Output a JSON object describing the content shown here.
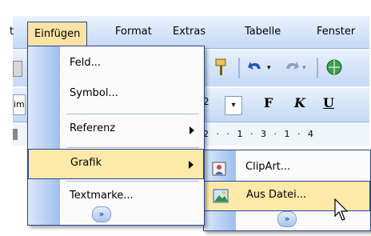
{
  "menubar": {
    "items": [
      {
        "label": "t"
      },
      {
        "label": "Einfügen"
      },
      {
        "label": "Format"
      },
      {
        "label": "Extras"
      },
      {
        "label": "Tabelle"
      },
      {
        "label": "Fenster"
      }
    ]
  },
  "toolbar": {
    "font_name_partial": "ime",
    "size_partial": "2",
    "bold_label": "F",
    "italic_label": "K",
    "underline_label": "U",
    "dropdown_glyph": "▾"
  },
  "ruler": {
    "ticks": [
      "2",
      "·",
      "·",
      "1",
      "·",
      "3",
      "·",
      "1",
      "·",
      "4"
    ]
  },
  "insert_menu": {
    "items": [
      {
        "label": "Feld..."
      },
      {
        "label": "Symbol..."
      },
      {
        "label": "Referenz"
      },
      {
        "label": "Grafik"
      },
      {
        "label": "Textmarke..."
      }
    ],
    "expand_glyph": "»"
  },
  "grafik_submenu": {
    "items": [
      {
        "label": "ClipArt..."
      },
      {
        "label": "Aus Datei..."
      }
    ],
    "expand_glyph": "»"
  },
  "colors": {
    "highlight": "#fde9a9",
    "border": "#2a468e",
    "menubar": "#c5d9f6"
  }
}
